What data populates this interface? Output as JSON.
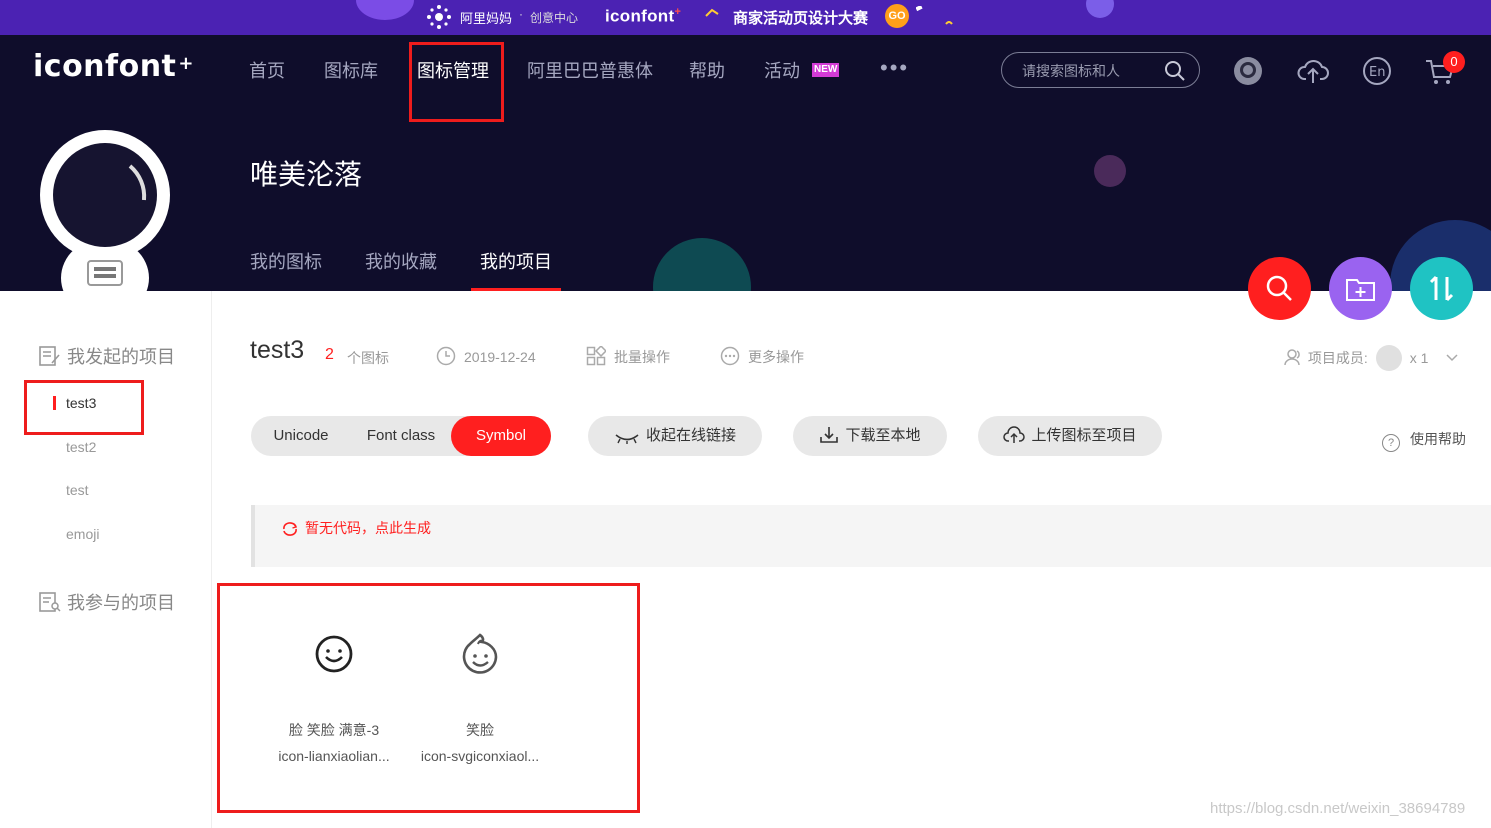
{
  "promo": {
    "alimama": "阿里妈妈",
    "separator": "·",
    "creative_center": "创意中心",
    "logo_text": "iconfont",
    "contest": "商家活动页设计大赛",
    "go_label": "GO"
  },
  "header": {
    "logo": "iconfont",
    "logo_plus": "+",
    "nav": [
      {
        "label": "首页"
      },
      {
        "label": "图标库"
      },
      {
        "label": "图标管理"
      },
      {
        "label": "阿里巴巴普惠体"
      },
      {
        "label": "帮助"
      },
      {
        "label": "活动"
      }
    ],
    "new_badge": "NEW",
    "more": "•••",
    "search_placeholder": "请搜索图标和人",
    "cart_count": "0"
  },
  "profile": {
    "username": "唯美沦落",
    "tabs": [
      {
        "label": "我的图标"
      },
      {
        "label": "我的收藏"
      },
      {
        "label": "我的项目"
      }
    ]
  },
  "fabs": {
    "search_color": "#ff1f1f",
    "add_folder_color": "#9a63f0",
    "sort_color": "#1fc3c3"
  },
  "sidebar": {
    "started_heading": "我发起的项目",
    "projects": [
      "test3",
      "test2",
      "test",
      "emoji"
    ],
    "joined_heading": "我参与的项目"
  },
  "project": {
    "name": "test3",
    "icon_count": "2",
    "icon_count_label": "个图标",
    "date": "2019-12-24",
    "batch_ops": "批量操作",
    "more_ops": "更多操作",
    "members_label": "项目成员:",
    "members_count": "x 1",
    "format_tabs": [
      "Unicode",
      "Font class",
      "Symbol"
    ],
    "collapse_link": "收起在线链接",
    "download_local": "下载至本地",
    "upload_icons": "上传图标至项目",
    "usage_help": "使用帮助",
    "help_glyph": "?",
    "no_code_msg": "暂无代码，点此生成"
  },
  "icons": [
    {
      "name": "脸 笑脸 满意-3",
      "code": "icon-lianxiaolian...",
      "icon": "smiley-face-icon"
    },
    {
      "name": "笑脸",
      "code": "icon-svgiconxiaol...",
      "icon": "baby-smiley-icon"
    }
  ],
  "watermark": "https://blog.csdn.net/weixin_38694789",
  "colors": {
    "accent": "#ff1f1f",
    "header_bg": "#0f0d2b",
    "promo_bg": "#4b22b3",
    "annotation": "#ee1c1c"
  }
}
